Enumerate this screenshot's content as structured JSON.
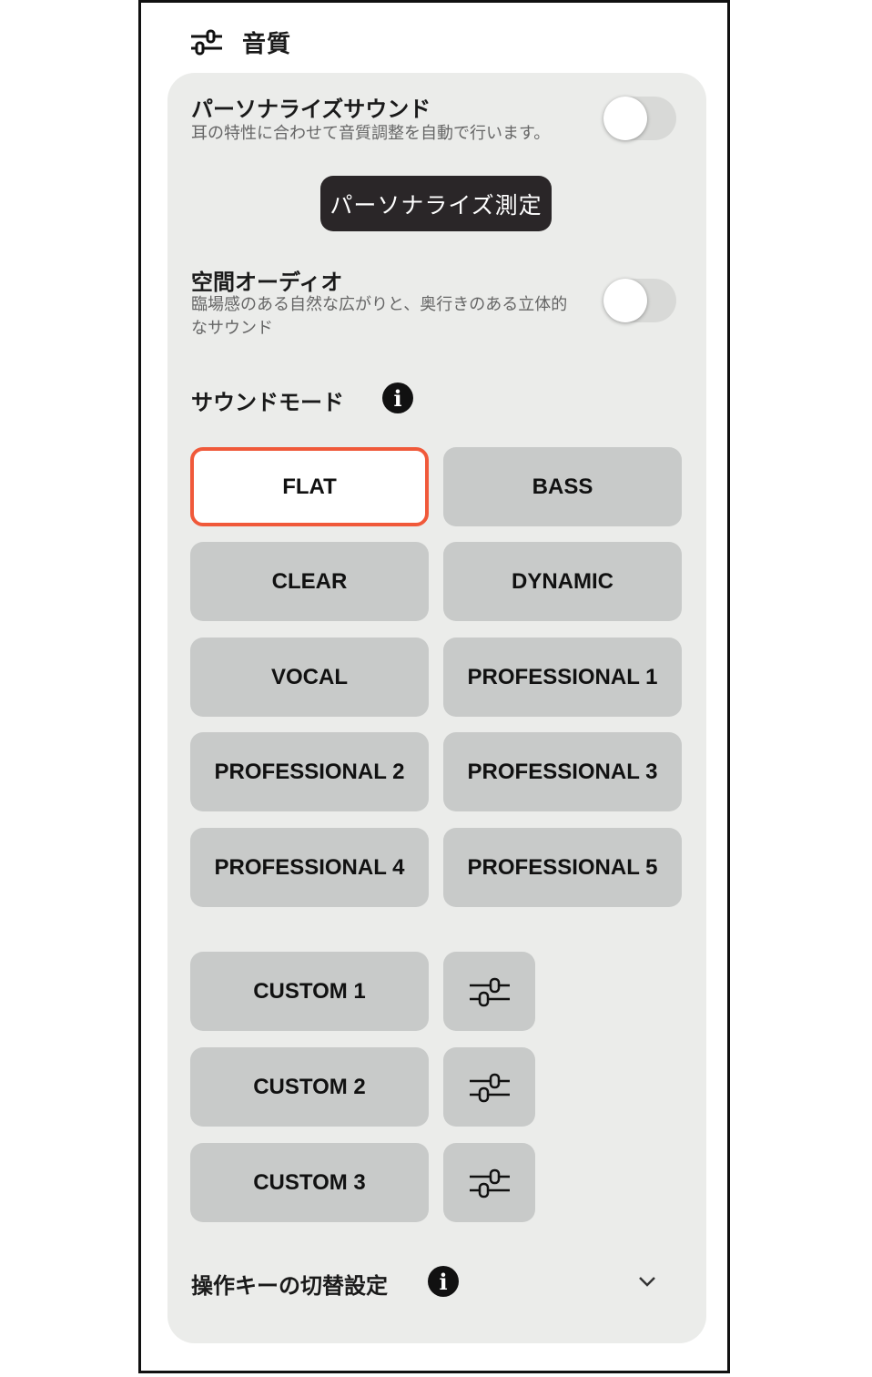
{
  "header": {
    "title": "音質",
    "icon": "equalizer-icon"
  },
  "personalize": {
    "title": "パーソナライズサウンド",
    "description": "耳の特性に合わせて音質調整を自動で行います。",
    "toggle_on": false,
    "measure_button": "パーソナライズ測定"
  },
  "spatial": {
    "title": "空間オーディオ",
    "description_line1": "臨場感のある自然な広がりと、奥行きのある立体的",
    "description_line2": "なサウンド",
    "toggle_on": false
  },
  "sound_mode": {
    "title": "サウンドモード",
    "info_icon": "info-icon",
    "selected": "FLAT",
    "modes": [
      "FLAT",
      "BASS",
      "CLEAR",
      "DYNAMIC",
      "VOCAL",
      "PROFESSIONAL 1",
      "PROFESSIONAL 2",
      "PROFESSIONAL 3",
      "PROFESSIONAL 4",
      "PROFESSIONAL 5"
    ],
    "customs": [
      "CUSTOM 1",
      "CUSTOM 2",
      "CUSTOM 3"
    ],
    "accent_color": "#f0593a"
  },
  "key_switch": {
    "title": "操作キーの切替設定",
    "info_icon": "info-icon",
    "expand_icon": "chevron-down-icon"
  }
}
